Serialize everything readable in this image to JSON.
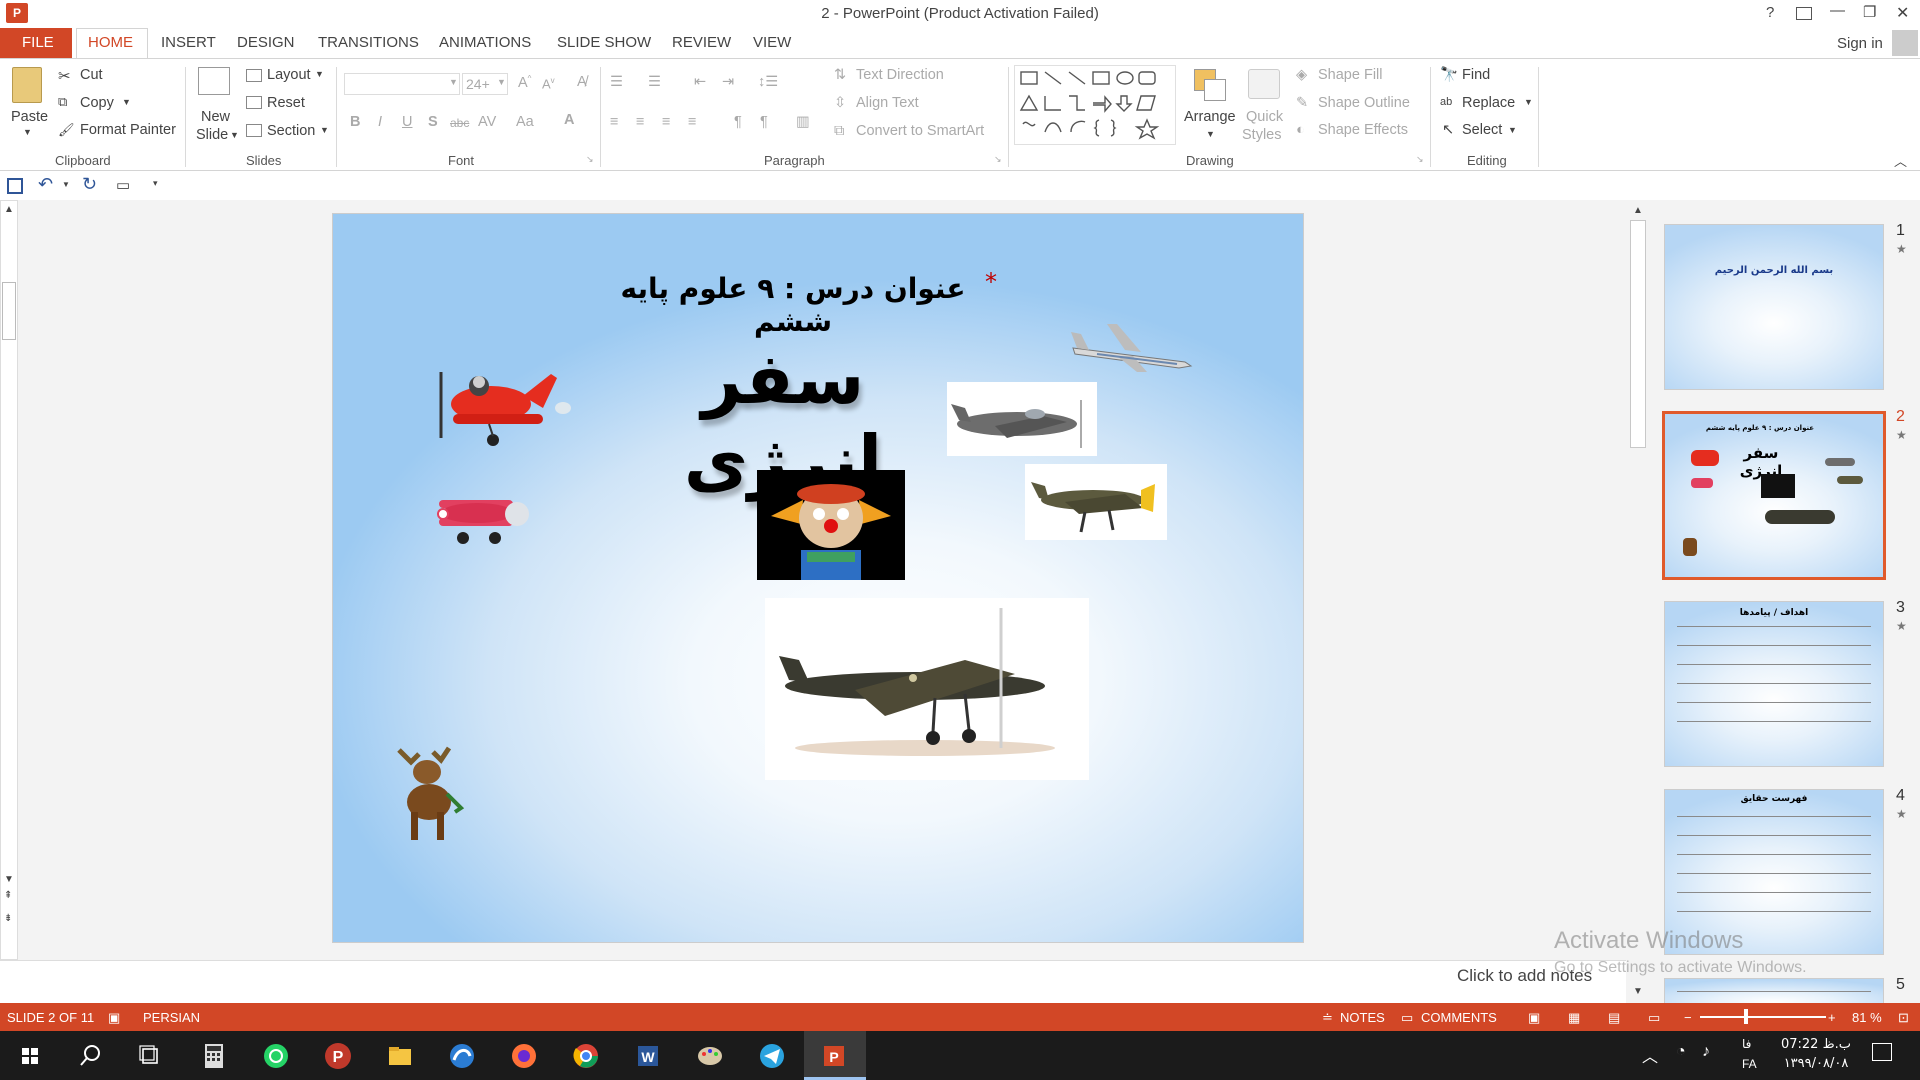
{
  "titlebar": {
    "title": "2 - PowerPoint (Product Activation Failed)",
    "help": "?",
    "minimize": "—",
    "restore": "❐",
    "close": "✕"
  },
  "tabs": {
    "file": "FILE",
    "home": "HOME",
    "insert": "INSERT",
    "design": "DESIGN",
    "transitions": "TRANSITIONS",
    "animations": "ANIMATIONS",
    "slideshow": "SLIDE SHOW",
    "review": "REVIEW",
    "view": "VIEW",
    "signin": "Sign in"
  },
  "ribbon": {
    "paste": "Paste",
    "cut": "Cut",
    "copy": "Copy",
    "format_painter": "Format Painter",
    "clipboard": "Clipboard",
    "new_slide_1": "New",
    "new_slide_2": "Slide",
    "layout": "Layout",
    "reset": "Reset",
    "section": "Section",
    "slides": "Slides",
    "font_size": "24+",
    "font": "Font",
    "text_direction": "Text Direction",
    "align_text": "Align Text",
    "convert_smartart": "Convert to SmartArt",
    "paragraph": "Paragraph",
    "arrange": "Arrange",
    "quick_1": "Quick",
    "quick_2": "Styles",
    "shape_fill": "Shape Fill",
    "shape_outline": "Shape Outline",
    "shape_effects": "Shape Effects",
    "drawing": "Drawing",
    "find": "Find",
    "replace": "Replace",
    "select": "Select",
    "editing": "Editing"
  },
  "slide": {
    "subtitle": "عنوان درس :  ۹ علوم پایه ششم",
    "asterisk": "*",
    "title": "سفر انرژی"
  },
  "thumbnails": [
    {
      "num": "1",
      "star": "★",
      "text": "بسم الله الرحمن الرحیم"
    },
    {
      "num": "2",
      "star": "★",
      "subtitle": "عنوان درس : ۹ علوم پایه ششم",
      "title": "سفر انرژی"
    },
    {
      "num": "3",
      "star": "★",
      "title": "اهداف / پیامدها"
    },
    {
      "num": "4",
      "star": "★",
      "title": "فهرست حقایق"
    },
    {
      "num": "5"
    }
  ],
  "notes_placeholder": "Click to add notes",
  "watermark": {
    "line1": "Activate Windows",
    "line2": "Go to Settings to activate Windows."
  },
  "status": {
    "slide": "SLIDE 2 OF 11",
    "language": "PERSIAN",
    "notes": "NOTES",
    "comments": "COMMENTS",
    "zoom": "81 %"
  },
  "taskbar": {
    "lang": "FA",
    "ime": "فا",
    "time": "07:22 ب.ظ",
    "date": "۱۳۹۹/۰۸/۰۸"
  },
  "colors": {
    "accent": "#d24726",
    "file_tab": "#d24726",
    "selected_border": "#e05a2b"
  }
}
